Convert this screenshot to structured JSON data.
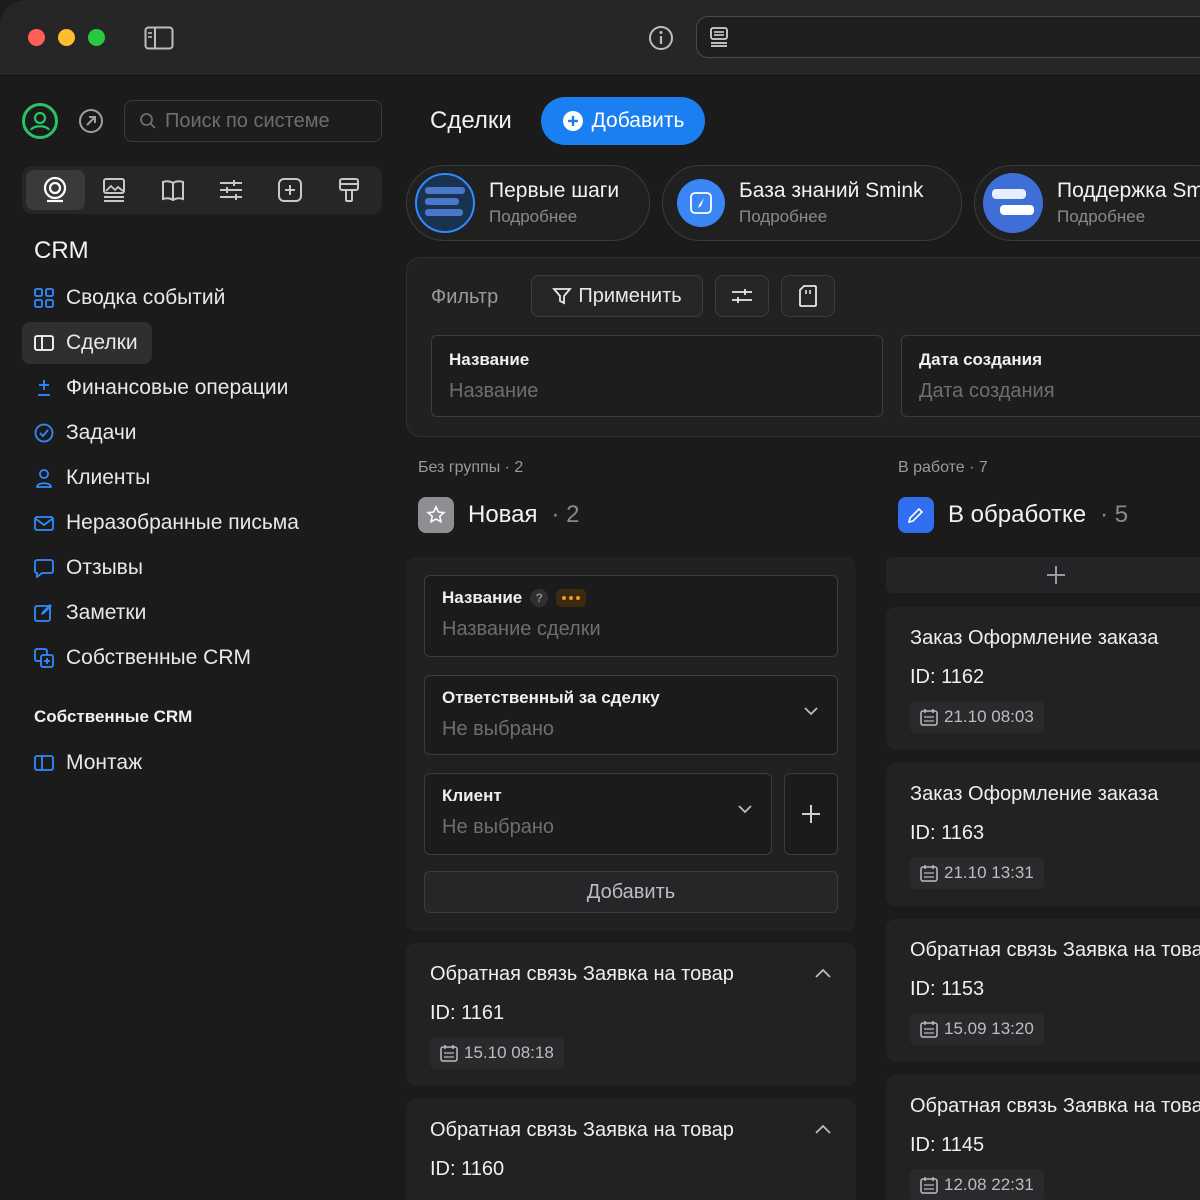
{
  "window": {
    "url": ""
  },
  "sidebar": {
    "search_placeholder": "Поиск по системе",
    "section_title": "CRM",
    "items": [
      {
        "label": "Сводка событий",
        "icon": "grid-icon"
      },
      {
        "label": "Сделки",
        "icon": "columns-icon",
        "active": true
      },
      {
        "label": "Финансовые операции",
        "icon": "plus-minus-icon"
      },
      {
        "label": "Задачи",
        "icon": "check-circle-icon"
      },
      {
        "label": "Клиенты",
        "icon": "user-icon"
      },
      {
        "label": "Неразобранные письма",
        "icon": "mail-icon"
      },
      {
        "label": "Отзывы",
        "icon": "chat-icon"
      },
      {
        "label": "Заметки",
        "icon": "edit-square-icon"
      },
      {
        "label": "Собственные CRM",
        "icon": "copy-plus-icon"
      }
    ],
    "sub_title": "Собственные CRM",
    "sub_items": [
      {
        "label": "Монтаж",
        "icon": "columns-icon"
      }
    ],
    "accent": "#2f8cff"
  },
  "main": {
    "title": "Сделки",
    "add_label": "Добавить",
    "promos": [
      {
        "title": "Первые шаги",
        "subtitle": "Подробнее"
      },
      {
        "title": "База знаний Smink",
        "subtitle": "Подробнее"
      },
      {
        "title": "Поддержка Smink",
        "subtitle": "Подробнее"
      }
    ],
    "filter": {
      "label": "Фильтр",
      "apply_label": "Применить",
      "fields": [
        {
          "label": "Название",
          "placeholder": "Название"
        },
        {
          "label": "Дата создания",
          "placeholder": "Дата создания"
        }
      ]
    },
    "columns": [
      {
        "group_meta": "Без группы · 2",
        "title": "Новая",
        "count": "· 2",
        "icon": "star-icon",
        "form": {
          "name_label": "Название",
          "name_help": "?",
          "name_placeholder": "Название сделки",
          "owner_label": "Ответственный за сделку",
          "owner_value": "Не выбрано",
          "client_label": "Клиент",
          "client_value": "Не выбрано",
          "submit_label": "Добавить"
        },
        "deals": [
          {
            "title": "Обратная связь Заявка на товар",
            "id": "ID: 1161",
            "date": "15.10 08:18"
          },
          {
            "title": "Обратная связь Заявка на товар",
            "id": "ID: 1160",
            "date": ""
          }
        ]
      },
      {
        "group_meta": "В работе · 7",
        "title": "В обработке",
        "count": "· 5",
        "icon": "pencil-icon",
        "deals": [
          {
            "title": "Заказ Оформление заказа",
            "id": "ID: 1162",
            "date": "21.10 08:03"
          },
          {
            "title": "Заказ Оформление заказа",
            "id": "ID: 1163",
            "date": "21.10 13:31"
          },
          {
            "title": "Обратная связь Заявка на товар",
            "id": "ID: 1153",
            "date": "15.09 13:20"
          },
          {
            "title": "Обратная связь Заявка на товар",
            "id": "ID: 1145",
            "date": "12.08 22:31"
          }
        ]
      }
    ]
  }
}
